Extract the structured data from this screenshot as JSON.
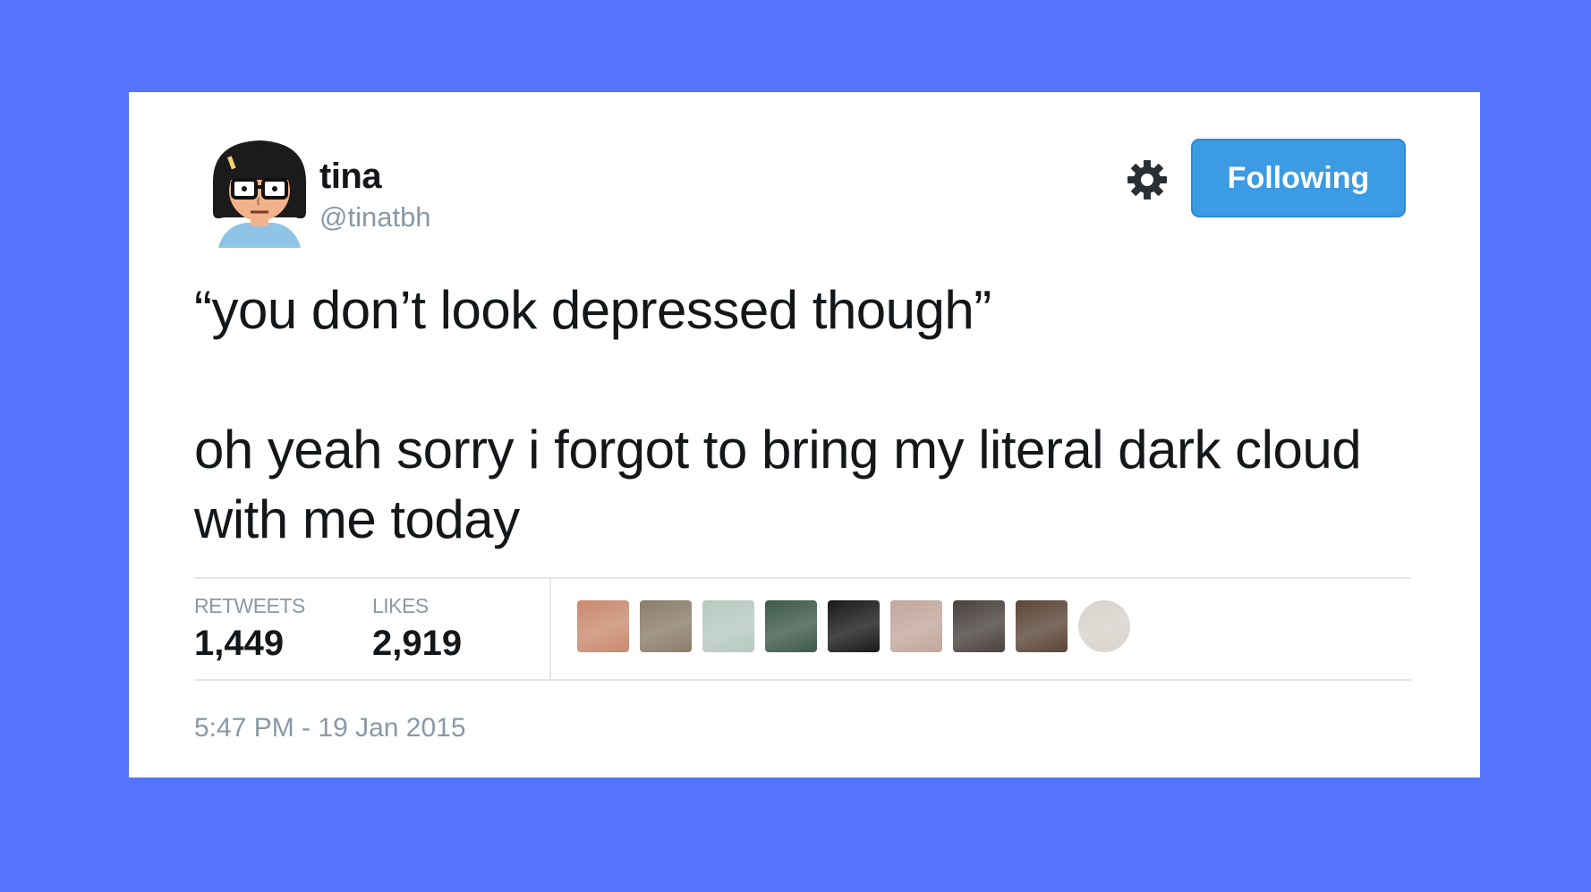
{
  "tweet": {
    "user": {
      "name": "tina",
      "handle": "@tinatbh"
    },
    "follow_button_label": "Following",
    "text_lines": [
      "“you don’t look depressed though”",
      "oh yeah sorry i forgot to bring my literal dark cloud with me today"
    ],
    "stats": {
      "retweets_label": "RETWEETS",
      "retweets_value": "1,449",
      "likes_label": "LIKES",
      "likes_value": "2,919"
    },
    "likers": [
      {
        "color": "#c98a6f"
      },
      {
        "color": "#8a7d6a"
      },
      {
        "color": "#b7c9c0"
      },
      {
        "color": "#3e5a4c"
      },
      {
        "color": "#1a1a1a"
      },
      {
        "color": "#c2a79c"
      },
      {
        "color": "#4a4240"
      },
      {
        "color": "#5a4637"
      },
      {
        "color": "#d9d2cc"
      }
    ],
    "timestamp": "5:47 PM - 19 Jan 2015"
  },
  "colors": {
    "background": "#5474fb",
    "card": "#ffffff",
    "button": "#3b9be3",
    "muted_text": "#8899a6"
  }
}
